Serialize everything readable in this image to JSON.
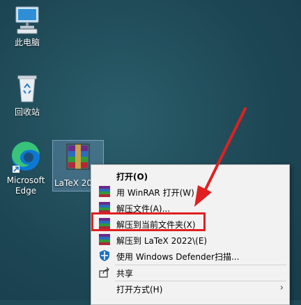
{
  "desktop": {
    "icons": [
      {
        "label": "此电脑"
      },
      {
        "label": "回收站"
      },
      {
        "label": "Microsoft Edge"
      },
      {
        "label": "LaTeX 202"
      }
    ]
  },
  "context_menu": {
    "items": [
      {
        "label": "打开(O)",
        "icon": "none"
      },
      {
        "label": "用 WinRAR 打开(W)",
        "icon": "winrar-icon"
      },
      {
        "label": "解压文件(A)...",
        "icon": "winrar-icon"
      },
      {
        "label": "解压到当前文件夹(X)",
        "icon": "winrar-icon"
      },
      {
        "label": "解压到 LaTeX 2022\\(E)",
        "icon": "winrar-icon"
      },
      {
        "label": "使用 Windows Defender扫描...",
        "icon": "defender-shield-icon"
      },
      {
        "label": "共享",
        "icon": "share-icon"
      },
      {
        "label": "打开方式(H)",
        "icon": "none"
      }
    ]
  },
  "colors": {
    "highlight": "#e02020",
    "arrow": "#e02020"
  }
}
